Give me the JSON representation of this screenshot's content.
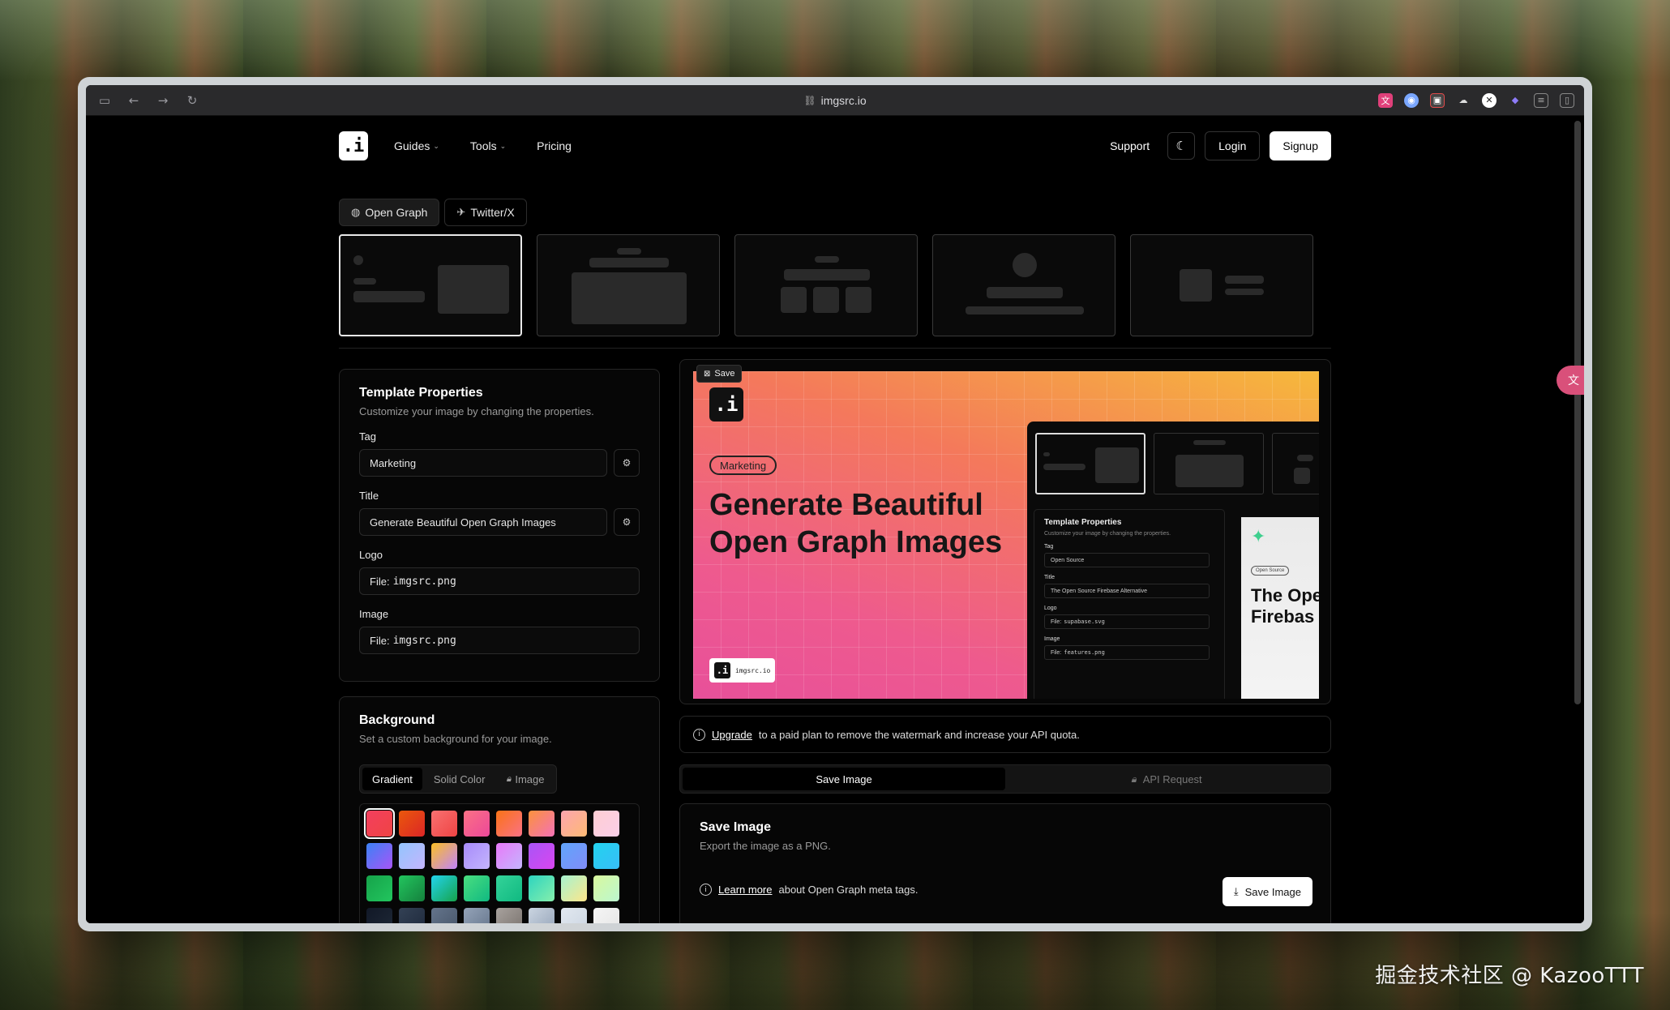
{
  "browser": {
    "url": "imgsrc.io",
    "link_icon": "link-icon"
  },
  "nav": {
    "logo": ".i",
    "guides": "Guides",
    "tools": "Tools",
    "pricing": "Pricing",
    "support": "Support",
    "login": "Login",
    "signup": "Signup"
  },
  "tabs": [
    {
      "label": "Open Graph",
      "icon": "globe-icon"
    },
    {
      "label": "Twitter/X",
      "icon": "bird-icon"
    }
  ],
  "properties": {
    "title": "Template Properties",
    "subtitle": "Customize your image by changing the properties.",
    "tag_label": "Tag",
    "tag_value": "Marketing",
    "title_label": "Title",
    "title_value": "Generate Beautiful Open Graph Images",
    "logo_label": "Logo",
    "logo_prefix": "File:",
    "logo_file": "imgsrc.png",
    "image_label": "Image",
    "image_prefix": "File:",
    "image_file": "imgsrc.png"
  },
  "background": {
    "title": "Background",
    "subtitle": "Set a custom background for your image.",
    "modes": [
      "Gradient",
      "Solid Color",
      "Image"
    ],
    "swatches": [
      [
        "#f43f5e",
        "#ef4444"
      ],
      [
        "#ea580c",
        "#dc2626"
      ],
      [
        "#f87171",
        "#ef4444"
      ],
      [
        "#fb7185",
        "#ec4899"
      ],
      [
        "#f97316",
        "#fb7185"
      ],
      [
        "#fb923c",
        "#f472b6"
      ],
      [
        "#fda4af",
        "#fdba74"
      ],
      [
        "#fecdd3",
        "#fbcfe8"
      ],
      [
        "#3b82f6",
        "#a855f7"
      ],
      [
        "#93c5fd",
        "#c4b5fd"
      ],
      [
        "#fbbf24",
        "#c084fc"
      ],
      [
        "#a78bfa",
        "#c4b5fd"
      ],
      [
        "#e879f9",
        "#c4b5fd"
      ],
      [
        "#a855f7",
        "#d946ef"
      ],
      [
        "#60a5fa",
        "#818cf8"
      ],
      [
        "#22d3ee",
        "#38bdf8"
      ],
      [
        "#16a34a",
        "#22c55e"
      ],
      [
        "#22c55e",
        "#15803d"
      ],
      [
        "#22d3ee",
        "#16a34a"
      ],
      [
        "#4ade80",
        "#10b981"
      ],
      [
        "#34d399",
        "#10b981"
      ],
      [
        "#2dd4bf",
        "#86efac"
      ],
      [
        "#a7f3d0",
        "#fde68a"
      ],
      [
        "#d9f99d",
        "#bbf7d0"
      ],
      [
        "#111827",
        "#1f2937"
      ],
      [
        "#334155",
        "#1e293b"
      ],
      [
        "#64748b",
        "#475569"
      ],
      [
        "#94a3b8",
        "#64748b"
      ],
      [
        "#a8a29e",
        "#78716c"
      ],
      [
        "#cbd5e1",
        "#94a3b8"
      ],
      [
        "#e2e8f0",
        "#cbd5e1"
      ],
      [
        "#f5f5f5",
        "#e5e5e5"
      ]
    ]
  },
  "preview": {
    "save_badge": "Save",
    "logo": ".i",
    "tag": "Marketing",
    "title": "Generate Beautiful Open Graph Images",
    "watermark_logo": ".i",
    "watermark_text": "imgsrc.io",
    "shot": {
      "title": "Template Properties",
      "subtitle": "Customize your image by changing the properties.",
      "tag_label": "Tag",
      "tag_value": "Open Source",
      "title_label": "Title",
      "title_value": "The Open Source Firebase Alternative",
      "logo_label": "Logo",
      "logo_prefix": "File:",
      "logo_file": "supabase.svg",
      "image_label": "Image",
      "image_prefix": "File:",
      "image_file": "features.png",
      "preview_tag": "Open Source",
      "preview_title_1": "The Ope",
      "preview_title_2": "Firebas"
    }
  },
  "notice": {
    "link": "Upgrade",
    "text": "to a paid plan to remove the watermark and increase your API quota."
  },
  "actions": {
    "save_image_tab": "Save Image",
    "api_request_tab": "API Request"
  },
  "save_card": {
    "title": "Save Image",
    "subtitle": "Export the image as a PNG.",
    "learn_link": "Learn more",
    "learn_text": "about Open Graph meta tags.",
    "button": "Save Image"
  },
  "watermark": "掘金技术社区 @ KazooTTT"
}
